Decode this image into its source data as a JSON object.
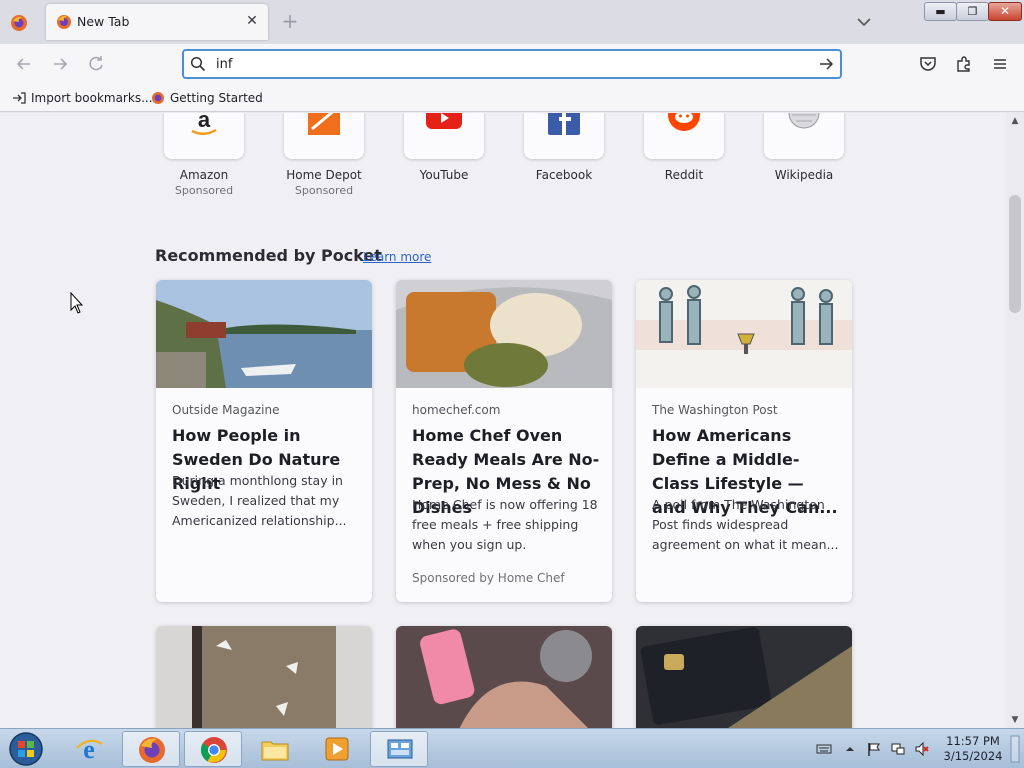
{
  "browser": {
    "tab": {
      "title": "New Tab",
      "close_symbol": "✕"
    },
    "new_tab_symbol": "+",
    "url_bar": {
      "value": "inf"
    },
    "bookmarks": [
      {
        "label": "Import bookmarks...",
        "icon": "import-icon"
      },
      {
        "label": "Getting Started",
        "icon": "firefox-icon"
      }
    ]
  },
  "top_sites": [
    {
      "name": "Amazon",
      "sponsor": "Sponsored"
    },
    {
      "name": "Home Depot",
      "sponsor": "Sponsored"
    },
    {
      "name": "YouTube",
      "sponsor": ""
    },
    {
      "name": "Facebook",
      "sponsor": ""
    },
    {
      "name": "Reddit",
      "sponsor": ""
    },
    {
      "name": "Wikipedia",
      "sponsor": ""
    }
  ],
  "pocket": {
    "title": "Recommended by Pocket",
    "learn_more": "Learn more",
    "cards": [
      {
        "source": "Outside Magazine",
        "title": "How People in Sweden Do Nature Right",
        "excerpt": "During a monthlong stay in Sweden, I realized that my Americanized relationship...",
        "sponsored": ""
      },
      {
        "source": "homechef.com",
        "title": "Home Chef Oven Ready Meals Are No-Prep, No Mess & No Dishes",
        "excerpt": "Home Chef is now offering 18 free meals + free shipping when you sign up.",
        "sponsored": "Sponsored by Home Chef"
      },
      {
        "source": "The Washington Post",
        "title": "How Americans Define a Middle-Class Lifestyle — and Why They Can...",
        "excerpt": "A poll from The Washington Post finds widespread agreement on what it mean...",
        "sponsored": ""
      }
    ]
  },
  "taskbar": {
    "clock_time": "11:57 PM",
    "clock_date": "3/15/2024"
  },
  "colors": {
    "accent": "#4c8fd6",
    "link": "#2a64c8",
    "close_button": "#c8452f"
  }
}
